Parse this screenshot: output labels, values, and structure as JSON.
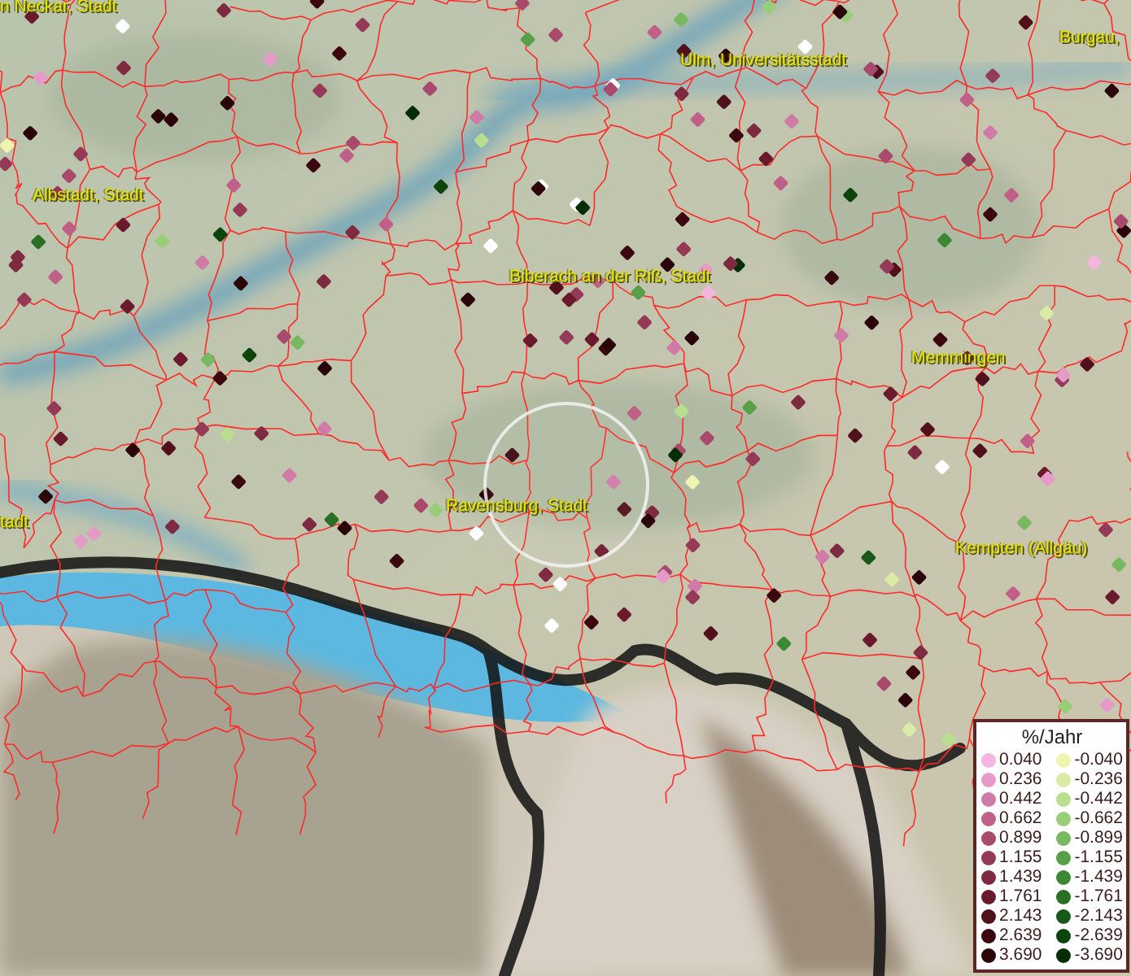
{
  "map": {
    "place_labels": [
      "n Neckar, Stadt",
      "Ulm, Universitätsstadt",
      "Burgau,",
      "Albstadt, Stadt",
      "Biberach an der Riß, Stadt",
      "Memmingen",
      "Ravensburg, Stadt",
      "tadt",
      "Kempten (Allgäu)"
    ]
  },
  "legend": {
    "title": "%/Jahr",
    "rows": [
      {
        "positive": {
          "value": "0.040",
          "color": "#f4b6e0"
        },
        "negative": {
          "value": "-0.040",
          "color": "#f0f4b0"
        }
      },
      {
        "positive": {
          "value": "0.236",
          "color": "#e59ac8"
        },
        "negative": {
          "value": "-0.236",
          "color": "#d8eca8"
        }
      },
      {
        "positive": {
          "value": "0.442",
          "color": "#d07aa8"
        },
        "negative": {
          "value": "-0.442",
          "color": "#b8de90"
        }
      },
      {
        "positive": {
          "value": "0.662",
          "color": "#c06088"
        },
        "negative": {
          "value": "-0.662",
          "color": "#98ce78"
        }
      },
      {
        "positive": {
          "value": "0.899",
          "color": "#a84a6c"
        },
        "negative": {
          "value": "-0.899",
          "color": "#78b860"
        }
      },
      {
        "positive": {
          "value": "1.155",
          "color": "#943a56"
        },
        "negative": {
          "value": "-1.155",
          "color": "#58a048"
        }
      },
      {
        "positive": {
          "value": "1.439",
          "color": "#7e2a40"
        },
        "negative": {
          "value": "-1.439",
          "color": "#3c8834"
        }
      },
      {
        "positive": {
          "value": "1.761",
          "color": "#6a1a2c"
        },
        "negative": {
          "value": "-1.761",
          "color": "#287024"
        }
      },
      {
        "positive": {
          "value": "2.143",
          "color": "#50101c"
        },
        "negative": {
          "value": "-2.143",
          "color": "#185818"
        }
      },
      {
        "positive": {
          "value": "2.639",
          "color": "#3c0810"
        },
        "negative": {
          "value": "-2.639",
          "color": "#0c440c"
        }
      },
      {
        "positive": {
          "value": "3.690",
          "color": "#2a0408"
        },
        "negative": {
          "value": "-3.690",
          "color": "#062e06"
        }
      }
    ]
  }
}
